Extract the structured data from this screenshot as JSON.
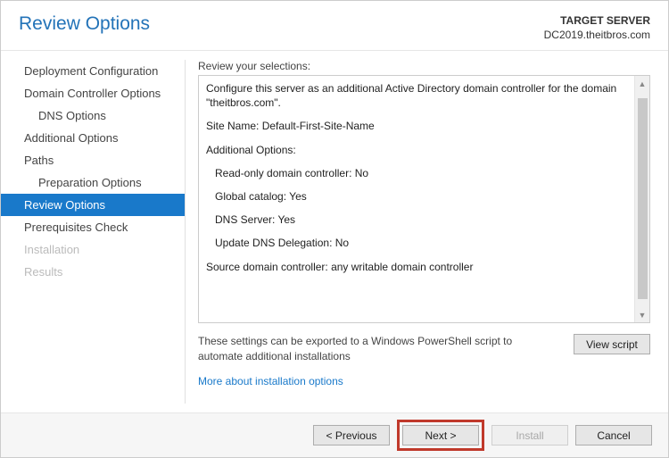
{
  "header": {
    "title": "Review Options",
    "target_label": "TARGET SERVER",
    "target_server": "DC2019.theitbros.com"
  },
  "sidebar": {
    "items": [
      {
        "label": "Deployment Configuration",
        "state": "normal",
        "indent": false
      },
      {
        "label": "Domain Controller Options",
        "state": "normal",
        "indent": false
      },
      {
        "label": "DNS Options",
        "state": "normal",
        "indent": true
      },
      {
        "label": "Additional Options",
        "state": "normal",
        "indent": false
      },
      {
        "label": "Paths",
        "state": "normal",
        "indent": false
      },
      {
        "label": "Preparation Options",
        "state": "normal",
        "indent": true
      },
      {
        "label": "Review Options",
        "state": "selected",
        "indent": false
      },
      {
        "label": "Prerequisites Check",
        "state": "normal",
        "indent": false
      },
      {
        "label": "Installation",
        "state": "disabled",
        "indent": false
      },
      {
        "label": "Results",
        "state": "disabled",
        "indent": false
      }
    ]
  },
  "main": {
    "review_label": "Review your selections:",
    "review_lines": {
      "l0": "Configure this server as an additional Active Directory domain controller for the domain \"theitbros.com\".",
      "l1": "Site Name: Default-First-Site-Name",
      "l2": "Additional Options:",
      "l3": "Read-only domain controller: No",
      "l4": "Global catalog: Yes",
      "l5": "DNS Server: Yes",
      "l6": "Update DNS Delegation: No",
      "l7": "Source domain controller: any writable domain controller"
    },
    "export_text": "These settings can be exported to a Windows PowerShell script to automate additional installations",
    "view_script_label": "View script",
    "more_link": "More about installation options"
  },
  "footer": {
    "previous": "< Previous",
    "next": "Next >",
    "install": "Install",
    "cancel": "Cancel"
  }
}
